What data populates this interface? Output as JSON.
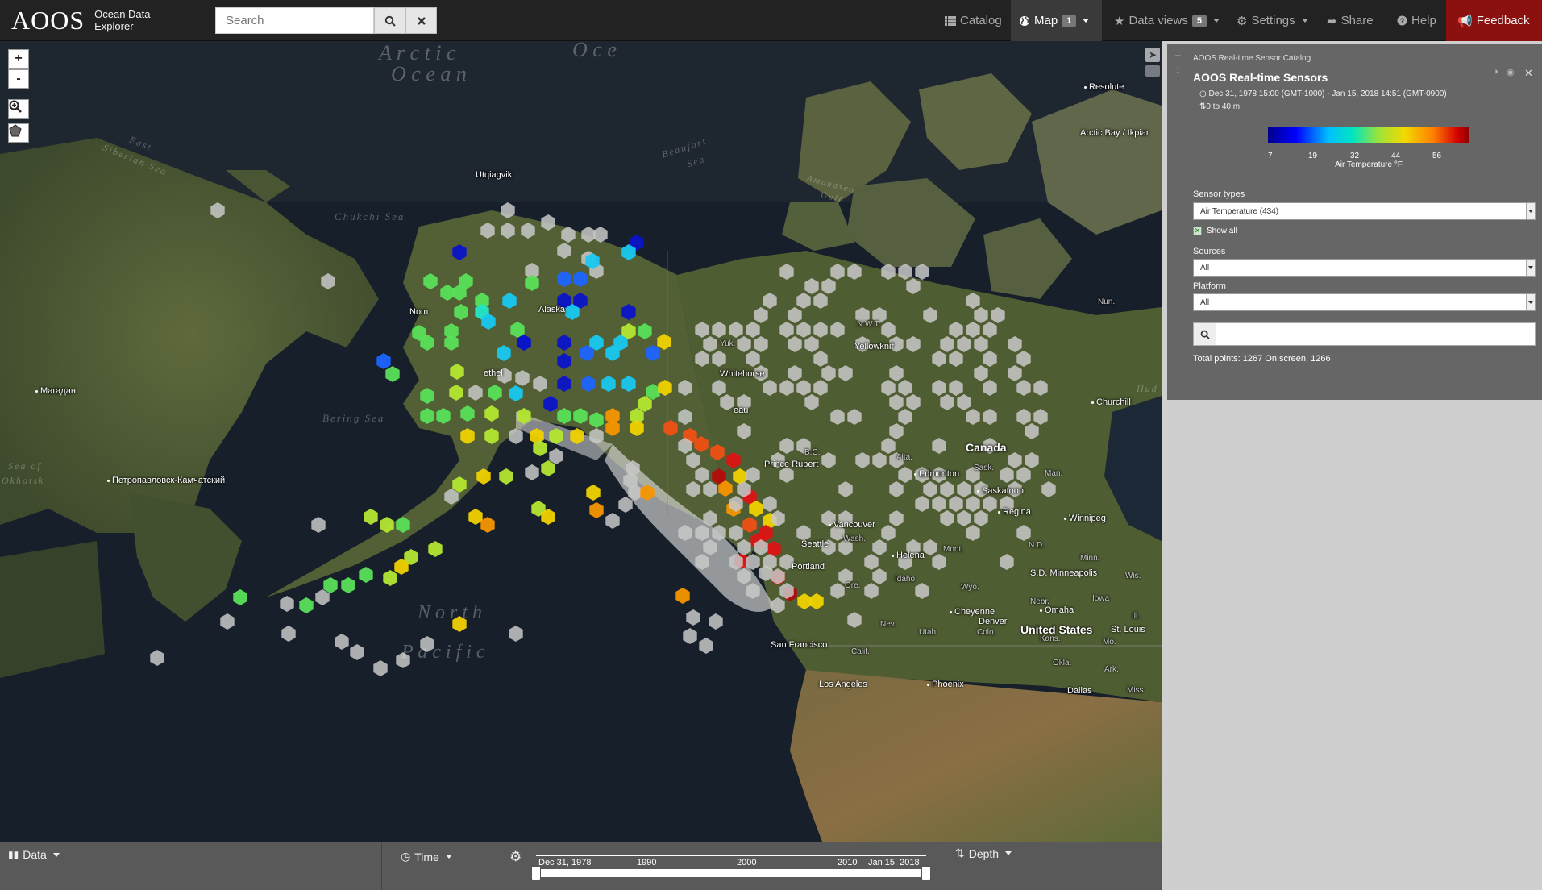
{
  "brand": {
    "logo_text": "AOOS",
    "line1": "Ocean Data",
    "line2": "Explorer"
  },
  "search": {
    "placeholder": "Search"
  },
  "nav": {
    "catalog": "Catalog",
    "map": "Map",
    "map_badge": "1",
    "data_views": "Data views",
    "data_views_badge": "5",
    "settings": "Settings",
    "share": "Share",
    "help": "Help",
    "feedback": "Feedback"
  },
  "map_controls": {
    "zoom_in": "+",
    "zoom_out": "-"
  },
  "map_labels": {
    "utqiagvik": "Utqiagvik",
    "alaska": "Alaska",
    "nome": "Nom",
    "bethel": "ethel",
    "magadan": "Магадан",
    "petropavlovsk": "Петропавловск-Камчатский",
    "whitehorse": "Whitehorse",
    "yukon": "Yuk.",
    "juneau": "eau",
    "nwt": "N.W.T.",
    "yellowknife": "Yellowknif",
    "resolute": "Resolute",
    "arctic_bay": "Arctic Bay / Ikpiar",
    "nunavut": "Nun.",
    "churchill": "Churchill",
    "canada": "Canada",
    "bc": "B.C.",
    "prince_rupert": "Prince Rupert",
    "alta": "Alta.",
    "edmonton": "Edmonton",
    "sask": "Sask.",
    "man": "Man.",
    "saskatoon": "Saskatoon",
    "regina": "Regina",
    "winnipeg": "Winnipeg",
    "vancouver": "Vancouver",
    "wash": "Wash.",
    "seattle": "Seattle",
    "portland": "Portland",
    "helena": "Helena",
    "mont": "Mont.",
    "nd": "N.D.",
    "minn": "Minn.",
    "minneapolis": "S.D. Minneapolis",
    "wis": "Wis.",
    "ore": "Ore.",
    "idaho": "Idaho",
    "wyo": "Wyo.",
    "nebr": "Nebr.",
    "iowa": "Iowa",
    "cheyenne": "Cheyenne",
    "denver": "Denver",
    "omaha": "Omaha",
    "colo": "Colo.",
    "kans": "Kans.",
    "united_states": "United States",
    "st_louis": "St. Louis",
    "mo": "Mo.",
    "ill": "Ill.",
    "nev": "Nev.",
    "utah": "Utah",
    "calif": "Calif.",
    "san_francisco": "San Francisco",
    "los_angeles": "Los Angeles",
    "phoenix": "Phoenix",
    "okla": "Okla.",
    "ark": "Ark.",
    "dallas": "Dallas",
    "miss": "Miss",
    "chukchi_sea": "Chukchi Sea",
    "bering_sea": "Bering Sea",
    "sea_of_okhotsk_1": "Sea of",
    "sea_of_okhotsk_2": "Okhotsk",
    "east_siberian_1": "East",
    "east_siberian_2": "Siberian Sea",
    "beaufort_1": "Beaufort",
    "beaufort_2": "Sea",
    "amundsen_1": "Amundsen",
    "amundsen_2": "Gulf",
    "arctic_1": "A r c t i c",
    "arctic_2": "O c e a n",
    "arctic_3": "O c e",
    "north_pacific_1": "N o r t h",
    "north_pacific_2": "P a c i f i c",
    "hud": "Hud"
  },
  "panel": {
    "catalog_name": "AOOS Real-time Sensor Catalog",
    "title": "AOOS Real-time Sensors",
    "time_range": "Dec 31, 1978 15:00 (GMT-1000) - Jan 15, 2018 14:51 (GMT-0900)",
    "depth_range": "0 to 40 m",
    "legend": {
      "ticks": [
        "7",
        "19",
        "32",
        "44",
        "56"
      ],
      "title": "Air Temperature °F"
    },
    "sensor_types_label": "Sensor types",
    "sensor_types_value": "Air Temperature (434)",
    "show_all_label": "Show all",
    "sources_label": "Sources",
    "sources_value": "All",
    "platform_label": "Platform",
    "platform_value": "All",
    "totals": "Total points: 1267 On screen: 1266"
  },
  "bottom": {
    "data": "Data",
    "time": "Time",
    "depth": "Depth",
    "start_date": "Dec 31, 1978",
    "end_date": "Jan 15, 2018",
    "ticks": [
      "1990",
      "2000",
      "2010"
    ]
  },
  "colors": {
    "navbar": "#222222",
    "feedback": "#8b1111",
    "panel_card": "#666666",
    "panel_bg": "#cfcfcf",
    "bottom_bar": "#595959",
    "hex_gray": "#c8c8c8",
    "hex_dark_blue": "#0a14c8",
    "hex_blue": "#1e64ff",
    "hex_cyan": "#18c8f0",
    "hex_aqua": "#22e6c8",
    "hex_green": "#5ae05a",
    "hex_lime": "#b4e632",
    "hex_yellow": "#f0d200",
    "hex_orange": "#f59600",
    "hex_red_orange": "#f05014",
    "hex_red": "#dc1414",
    "hex_dark_red": "#b40a0a"
  }
}
